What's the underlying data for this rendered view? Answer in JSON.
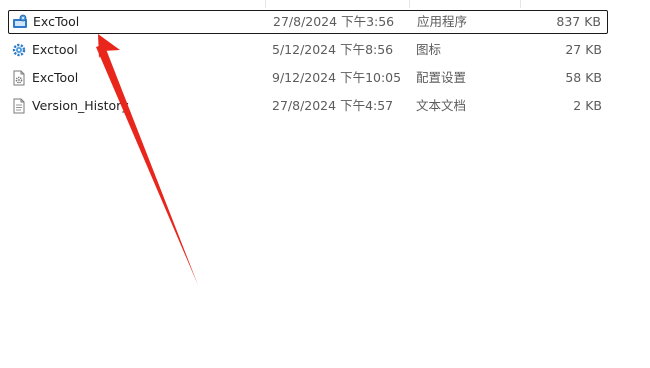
{
  "files": [
    {
      "name": "ExcTool",
      "date": "27/8/2024 下午3:56",
      "type": "应用程序",
      "size": "837 KB",
      "icon": "application-icon",
      "selected": true
    },
    {
      "name": "Exctool",
      "date": "5/12/2024 下午8:56",
      "type": "图标",
      "size": "27 KB",
      "icon": "gear-icon",
      "selected": false
    },
    {
      "name": "ExcTool",
      "date": "9/12/2024 下午10:05",
      "type": "配置设置",
      "size": "58 KB",
      "icon": "settings-file-icon",
      "selected": false
    },
    {
      "name": "Version_History",
      "date": "27/8/2024 下午4:57",
      "type": "文本文档",
      "size": "2 KB",
      "icon": "text-document-icon",
      "selected": false
    }
  ],
  "annotation": {
    "icon": "red-arrow-icon",
    "color": "#e8261c"
  }
}
